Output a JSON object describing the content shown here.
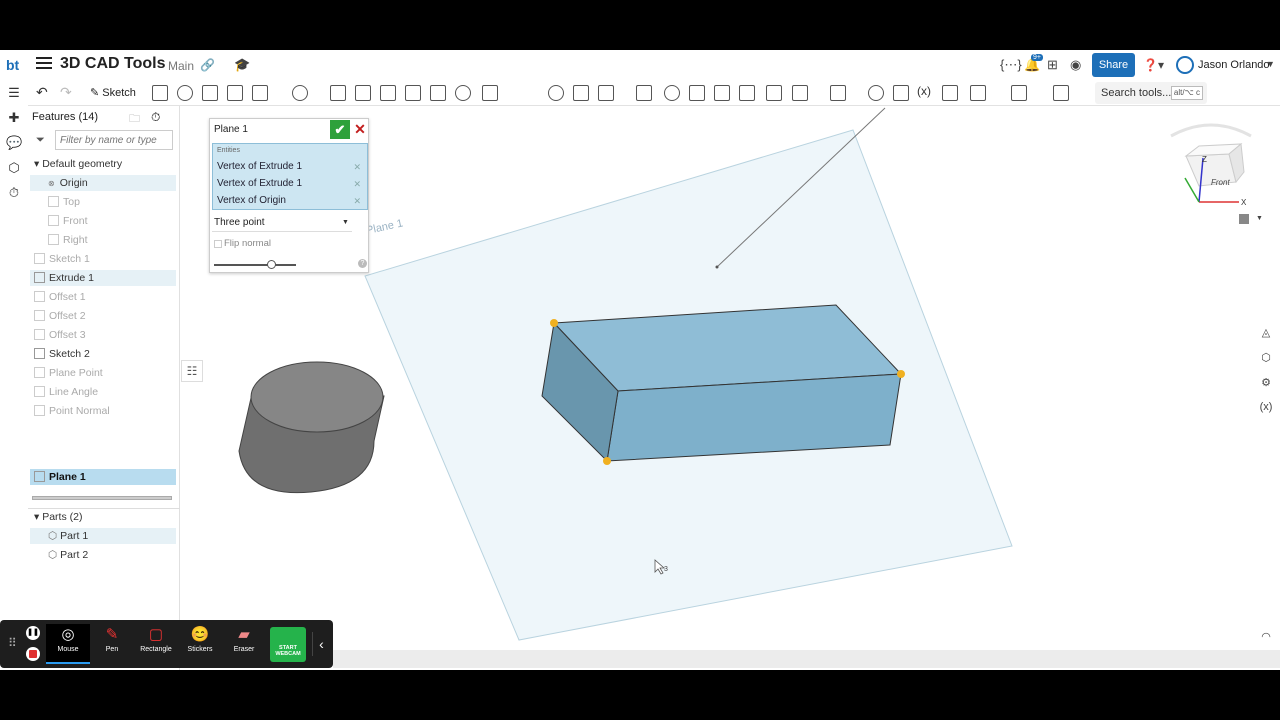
{
  "app": {
    "logo": "bt",
    "doc_title": "3D CAD Tools",
    "branch": "Main",
    "share_label": "Share",
    "user_name": "Jason Orlando",
    "notification_badge": "9+"
  },
  "toolbar": {
    "sketch_label": "Sketch",
    "search_label": "Search tools...",
    "search_shortcut": "alt/⌥ c"
  },
  "features": {
    "header": "Features (14)",
    "filter_placeholder": "Filter by name or type",
    "items": [
      {
        "label": "Default geometry"
      },
      {
        "label": "Origin"
      },
      {
        "label": "Top"
      },
      {
        "label": "Front"
      },
      {
        "label": "Right"
      },
      {
        "label": "Sketch 1"
      },
      {
        "label": "Extrude 1"
      },
      {
        "label": "Offset 1"
      },
      {
        "label": "Offset 2"
      },
      {
        "label": "Offset 3"
      },
      {
        "label": "Sketch 2"
      },
      {
        "label": "Plane Point"
      },
      {
        "label": "Line Angle"
      },
      {
        "label": "Point Normal"
      },
      {
        "label": "Plane 1"
      }
    ],
    "parts_header": "Parts (2)",
    "parts": [
      {
        "label": "Part 1"
      },
      {
        "label": "Part 2"
      }
    ]
  },
  "dialog": {
    "title": "Plane 1",
    "entities_label": "Entities",
    "entities": [
      {
        "label": "Vertex of Extrude 1"
      },
      {
        "label": "Vertex of Extrude 1"
      },
      {
        "label": "Vertex of Origin"
      }
    ],
    "type": "Three point",
    "flip_label": "Flip normal",
    "slider_fraction": 0.7
  },
  "viewport": {
    "plane_label": "Plane 1",
    "cursor_count": "3",
    "view_cube_label": "Front",
    "axis_x": "X",
    "axis_z": "Z"
  },
  "recorder": {
    "tools": [
      {
        "label": "Mouse"
      },
      {
        "label": "Pen"
      },
      {
        "label": "Rectangle"
      },
      {
        "label": "Stickers"
      },
      {
        "label": "Eraser"
      }
    ],
    "webcam_label": "START WEBCAM"
  },
  "colors": {
    "accent": "#1d6fb8",
    "selection": "#b8dcef",
    "part_fill": "#8fbdd6",
    "vertex": "#f0b020"
  }
}
